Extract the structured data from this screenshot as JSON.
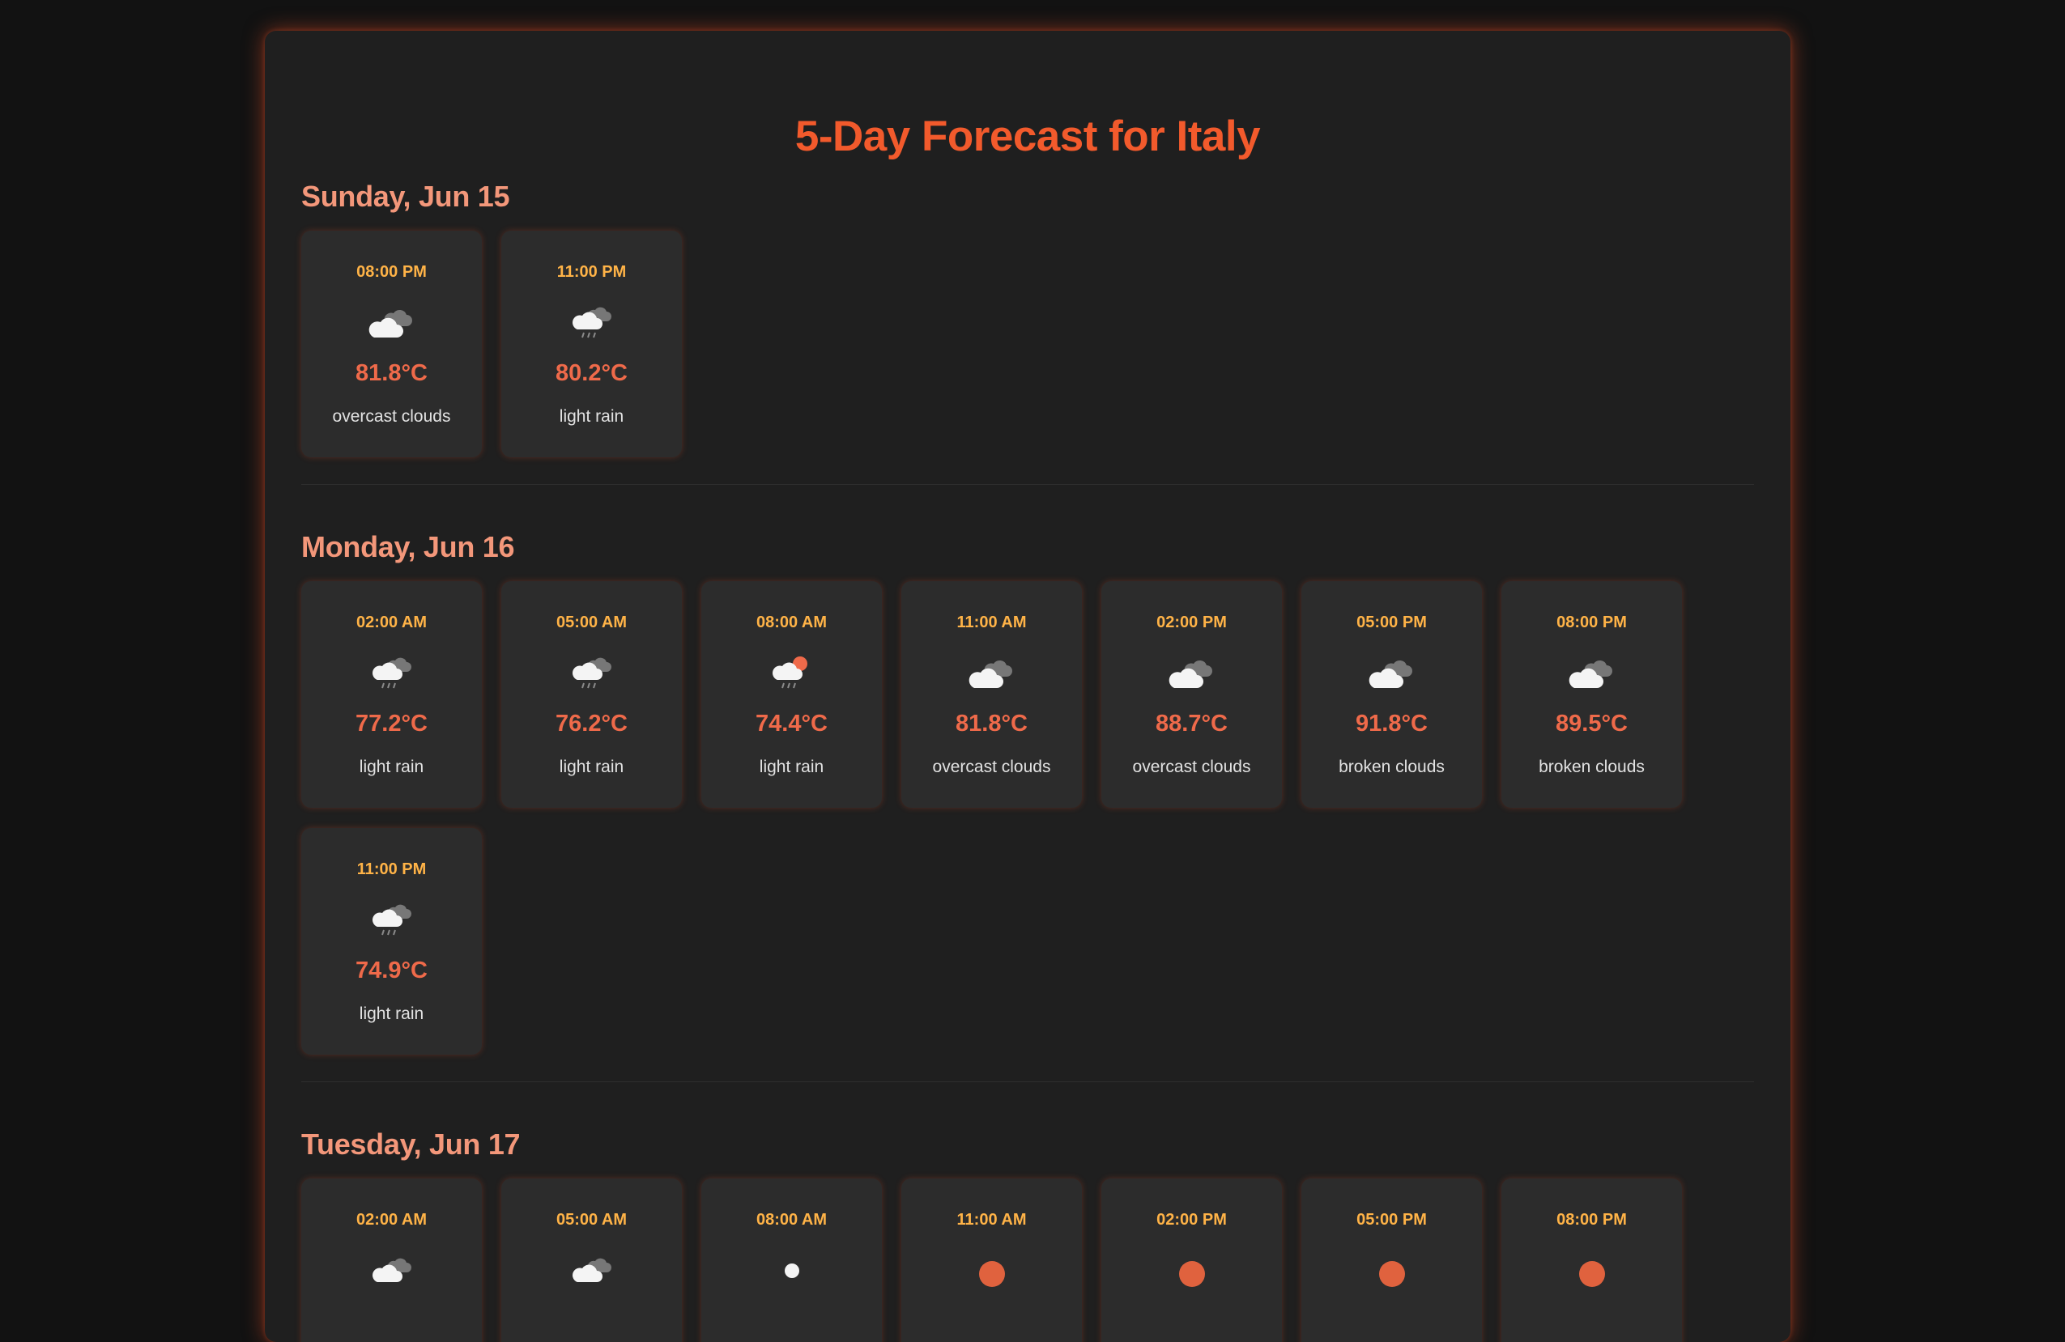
{
  "title": "5-Day Forecast for Italy",
  "colors": {
    "accent": "#f25a2c",
    "day_heading": "#f3977a",
    "time": "#ffb347",
    "temp": "#ef6a4a",
    "card_bg": "#2c2c2c",
    "panel_bg": "#1f1f1f",
    "page_bg": "#121212"
  },
  "days": [
    {
      "label": "Sunday, Jun 15",
      "forecasts": [
        {
          "time": "08:00 PM",
          "icon": "overcast-clouds-icon",
          "temp": "81.8°C",
          "desc": "overcast clouds"
        },
        {
          "time": "11:00 PM",
          "icon": "light-rain-night-icon",
          "temp": "80.2°C",
          "desc": "light rain"
        }
      ]
    },
    {
      "label": "Monday, Jun 16",
      "forecasts": [
        {
          "time": "02:00 AM",
          "icon": "light-rain-night-icon",
          "temp": "77.2°C",
          "desc": "light rain"
        },
        {
          "time": "05:00 AM",
          "icon": "light-rain-night-icon",
          "temp": "76.2°C",
          "desc": "light rain"
        },
        {
          "time": "08:00 AM",
          "icon": "light-rain-day-icon",
          "temp": "74.4°C",
          "desc": "light rain"
        },
        {
          "time": "11:00 AM",
          "icon": "overcast-clouds-icon",
          "temp": "81.8°C",
          "desc": "overcast clouds"
        },
        {
          "time": "02:00 PM",
          "icon": "overcast-clouds-icon",
          "temp": "88.7°C",
          "desc": "overcast clouds"
        },
        {
          "time": "05:00 PM",
          "icon": "broken-clouds-icon",
          "temp": "91.8°C",
          "desc": "broken clouds"
        },
        {
          "time": "08:00 PM",
          "icon": "broken-clouds-icon",
          "temp": "89.5°C",
          "desc": "broken clouds"
        },
        {
          "time": "11:00 PM",
          "icon": "light-rain-night-icon",
          "temp": "74.9°C",
          "desc": "light rain"
        }
      ]
    },
    {
      "label": "Tuesday, Jun 17",
      "forecasts": [
        {
          "time": "02:00 AM",
          "icon": "clouds-night-icon",
          "temp": "",
          "desc": ""
        },
        {
          "time": "05:00 AM",
          "icon": "clouds-night-icon",
          "temp": "",
          "desc": ""
        },
        {
          "time": "08:00 AM",
          "icon": "few-clouds-icon",
          "temp": "",
          "desc": ""
        },
        {
          "time": "11:00 AM",
          "icon": "sun-icon",
          "temp": "",
          "desc": ""
        },
        {
          "time": "02:00 PM",
          "icon": "sun-icon",
          "temp": "",
          "desc": ""
        },
        {
          "time": "05:00 PM",
          "icon": "sun-icon",
          "temp": "",
          "desc": ""
        },
        {
          "time": "08:00 PM",
          "icon": "sun-icon",
          "temp": "",
          "desc": ""
        }
      ]
    }
  ]
}
